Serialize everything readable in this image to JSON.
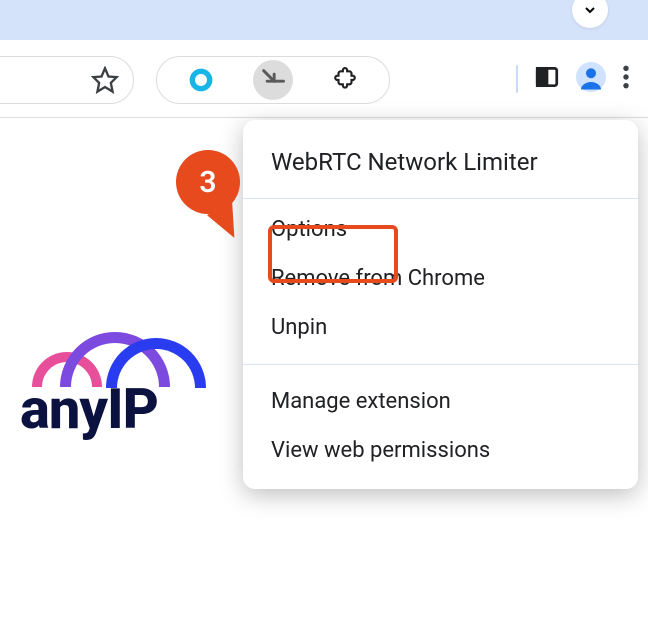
{
  "step_badge": "3",
  "menu": {
    "title": "WebRTC Network Limiter",
    "items_group1": [
      "Options",
      "Remove from Chrome",
      "Unpin"
    ],
    "items_group2": [
      "Manage extension",
      "View web permissions"
    ]
  },
  "logo": {
    "text": "anyIP"
  },
  "toolbar": {
    "icons": {
      "star": "star-icon",
      "circle": "circle-extension-icon",
      "arrow": "arrow-extension-icon",
      "puzzle": "extensions-icon",
      "panel": "side-panel-icon",
      "profile": "profile-icon",
      "overflow": "overflow-menu-icon",
      "chevron": "chevron-down-icon"
    }
  }
}
